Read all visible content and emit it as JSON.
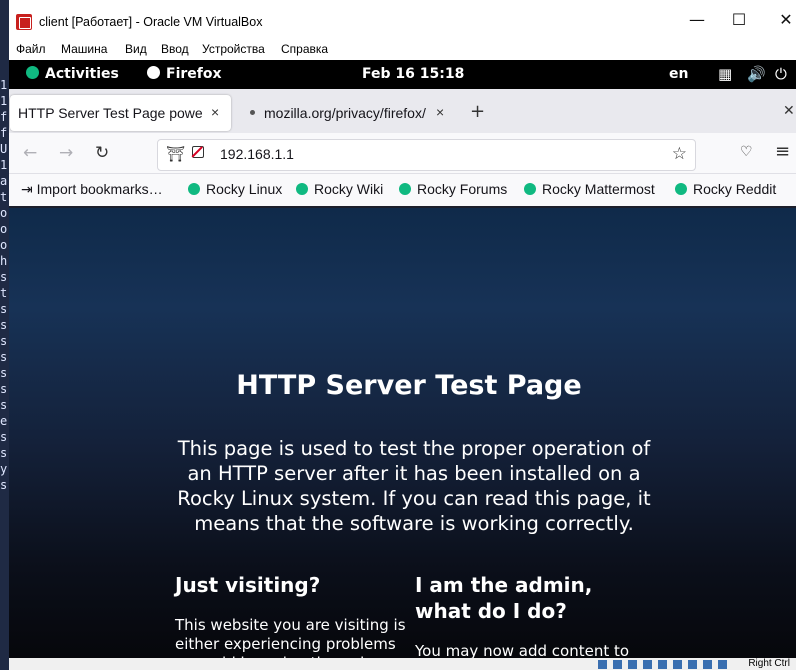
{
  "left_strip": {
    "chars": [
      "1",
      "1",
      "f",
      "f",
      "U",
      "1",
      "a",
      "t",
      "o",
      "o",
      "o",
      "h",
      "s",
      "t",
      "s",
      "s",
      "s",
      "s",
      "s",
      "s",
      "s",
      "e",
      "s",
      "s",
      "y",
      "s"
    ]
  },
  "window": {
    "title": "client [Работает] - Oracle VM VirtualBox"
  },
  "menu": [
    "Файл",
    "Машина",
    "Вид",
    "Ввод",
    "Устройства",
    "Справка"
  ],
  "gnome": {
    "activities": "Activities",
    "app": "Firefox",
    "clock": "Feb 16  15:18",
    "lang": "en"
  },
  "tabs": [
    {
      "label": "HTTP Server Test Page powered by",
      "close": "×"
    },
    {
      "label": "mozilla.org/privacy/firefox/",
      "close": "×"
    }
  ],
  "urlbar": {
    "url": "192.168.1.1"
  },
  "bookmarks": [
    "Import bookmarks…",
    "Rocky Linux",
    "Rocky Wiki",
    "Rocky Forums",
    "Rocky Mattermost",
    "Rocky Reddit"
  ],
  "page": {
    "heading": "HTTP Server Test Page",
    "intro": "This page is used to test the proper operation of an HTTP server after it has been installed on a Rocky Linux system. If you can read this page, it means that the software is working correctly.",
    "col1_heading": "Just visiting?",
    "col1_text": "This website you are visiting is either experiencing problems or could be going through maintenance.",
    "col2_heading": "I am the admin, what do I do?",
    "col2_text": "You may now add content to the webroot directory for your software."
  },
  "statusbar": {
    "right_ctrl": "Right Ctrl"
  }
}
